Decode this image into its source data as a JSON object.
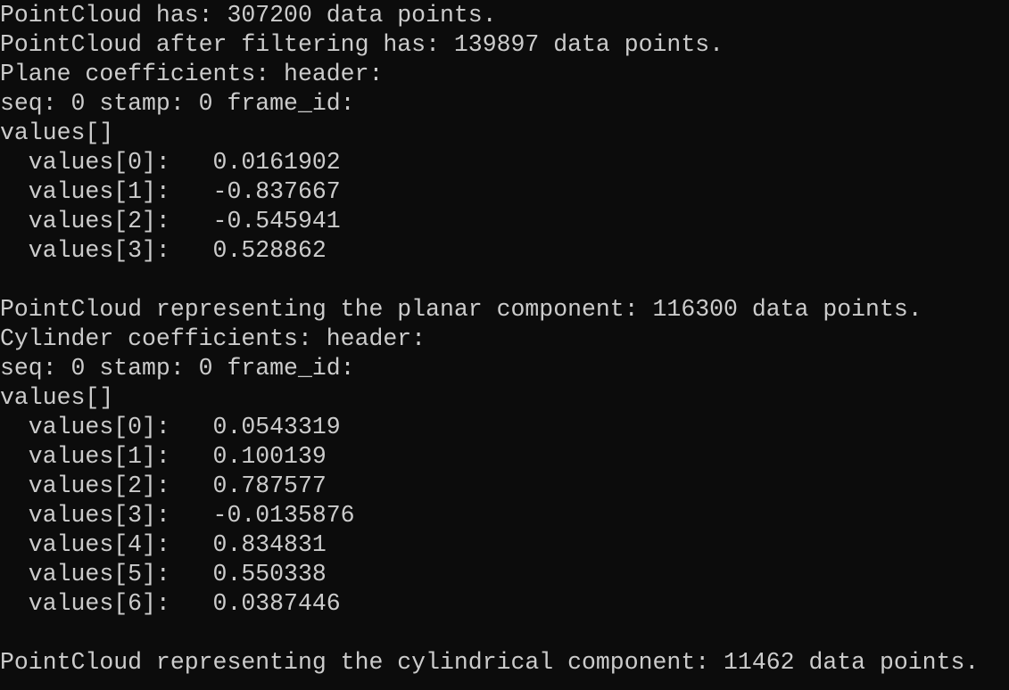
{
  "console": {
    "lines": [
      "PointCloud has: 307200 data points.",
      "PointCloud after filtering has: 139897 data points.",
      "Plane coefficients: header:",
      "seq: 0 stamp: 0 frame_id:",
      "values[]",
      "  values[0]:   0.0161902",
      "  values[1]:   -0.837667",
      "  values[2]:   -0.545941",
      "  values[3]:   0.528862",
      "",
      "PointCloud representing the planar component: 116300 data points.",
      "Cylinder coefficients: header:",
      "seq: 0 stamp: 0 frame_id:",
      "values[]",
      "  values[0]:   0.0543319",
      "  values[1]:   0.100139",
      "  values[2]:   0.787577",
      "  values[3]:   -0.0135876",
      "  values[4]:   0.834831",
      "  values[5]:   0.550338",
      "  values[6]:   0.0387446",
      "",
      "PointCloud representing the cylindrical component: 11462 data points."
    ]
  }
}
